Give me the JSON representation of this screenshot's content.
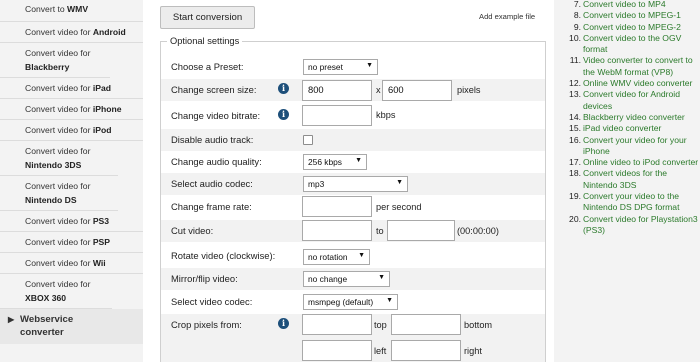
{
  "sidebar": {
    "items": [
      {
        "prefix": "Convert to ",
        "bold": "WMV"
      },
      {
        "prefix": "Convert video for ",
        "bold": "Android"
      },
      {
        "prefix": "Convert video for ",
        "bold": "Blackberry"
      },
      {
        "prefix": "Convert video for ",
        "bold": "iPad"
      },
      {
        "prefix": "Convert video for ",
        "bold": "iPhone"
      },
      {
        "prefix": "Convert video for ",
        "bold": "iPod"
      },
      {
        "prefix": "Convert video for ",
        "bold": "Nintendo 3DS"
      },
      {
        "prefix": "Convert video for ",
        "bold": "Nintendo DS"
      },
      {
        "prefix": "Convert video for ",
        "bold": "PS3"
      },
      {
        "prefix": "Convert video for ",
        "bold": "PSP"
      },
      {
        "prefix": "Convert video for ",
        "bold": "Wii"
      },
      {
        "prefix": "Convert video for ",
        "bold": "XBOX 360"
      }
    ],
    "webservice": {
      "arrow": "▶",
      "label_line1": "Webservice",
      "label_line2": "converter"
    }
  },
  "main": {
    "start_button": "Start conversion",
    "add_example": "Add example file",
    "legend": "Optional settings",
    "info_glyph": "i",
    "preset": {
      "label": "Choose a Preset:",
      "value": "no preset"
    },
    "screen_size": {
      "label": "Change screen size:",
      "width": "800",
      "x": "x",
      "height": "600",
      "unit": "pixels"
    },
    "bitrate": {
      "label": "Change video bitrate:",
      "value": "",
      "unit": "kbps"
    },
    "disable_audio": {
      "label": "Disable audio track:"
    },
    "audio_quality": {
      "label": "Change audio quality:",
      "value": "256 kbps"
    },
    "audio_codec": {
      "label": "Select audio codec:",
      "value": "mp3"
    },
    "frame_rate": {
      "label": "Change frame rate:",
      "value": "",
      "unit": "per second"
    },
    "cut_video": {
      "label": "Cut video:",
      "from": "",
      "to_label": "to",
      "to": "",
      "hint": "(00:00:00)"
    },
    "rotate": {
      "label": "Rotate video (clockwise):",
      "value": "no rotation"
    },
    "mirror": {
      "label": "Mirror/flip video:",
      "value": "no change"
    },
    "video_codec": {
      "label": "Select video codec:",
      "value": "msmpeg (default)"
    },
    "crop": {
      "label": "Crop pixels from:",
      "top_label": "top",
      "bottom_label": "bottom",
      "left_label": "left",
      "right_label": "right"
    },
    "select_arrow": "▼"
  },
  "right_list": [
    {
      "num": "7.",
      "text": "Convert video to MP4"
    },
    {
      "num": "8.",
      "text": "Convert video to MPEG-1"
    },
    {
      "num": "9.",
      "text": "Convert video to MPEG-2"
    },
    {
      "num": "10.",
      "text": "Convert video to the OGV format"
    },
    {
      "num": "11.",
      "text": "Video converter to convert to the WebM format (VP8)"
    },
    {
      "num": "12.",
      "text": "Online WMV video converter"
    },
    {
      "num": "13.",
      "text": "Convert video for Android devices"
    },
    {
      "num": "14.",
      "text": "Blackberry video converter"
    },
    {
      "num": "15.",
      "text": "iPad video converter"
    },
    {
      "num": "16.",
      "text": "Convert your video for your iPhone"
    },
    {
      "num": "17.",
      "text": "Online video to iPod converter"
    },
    {
      "num": "18.",
      "text": "Convert videos for the Nintendo 3DS"
    },
    {
      "num": "19.",
      "text": "Convert your video to the Nintendo DS DPG format"
    },
    {
      "num": "20.",
      "text": "Convert video for Playstation3 (PS3)"
    }
  ],
  "colors": {
    "link_green": "#2b7a2b",
    "info_blue": "#1d4f7a",
    "sidebar_bg": "#f3f3f3",
    "row_alt": "#f2f2f2"
  }
}
